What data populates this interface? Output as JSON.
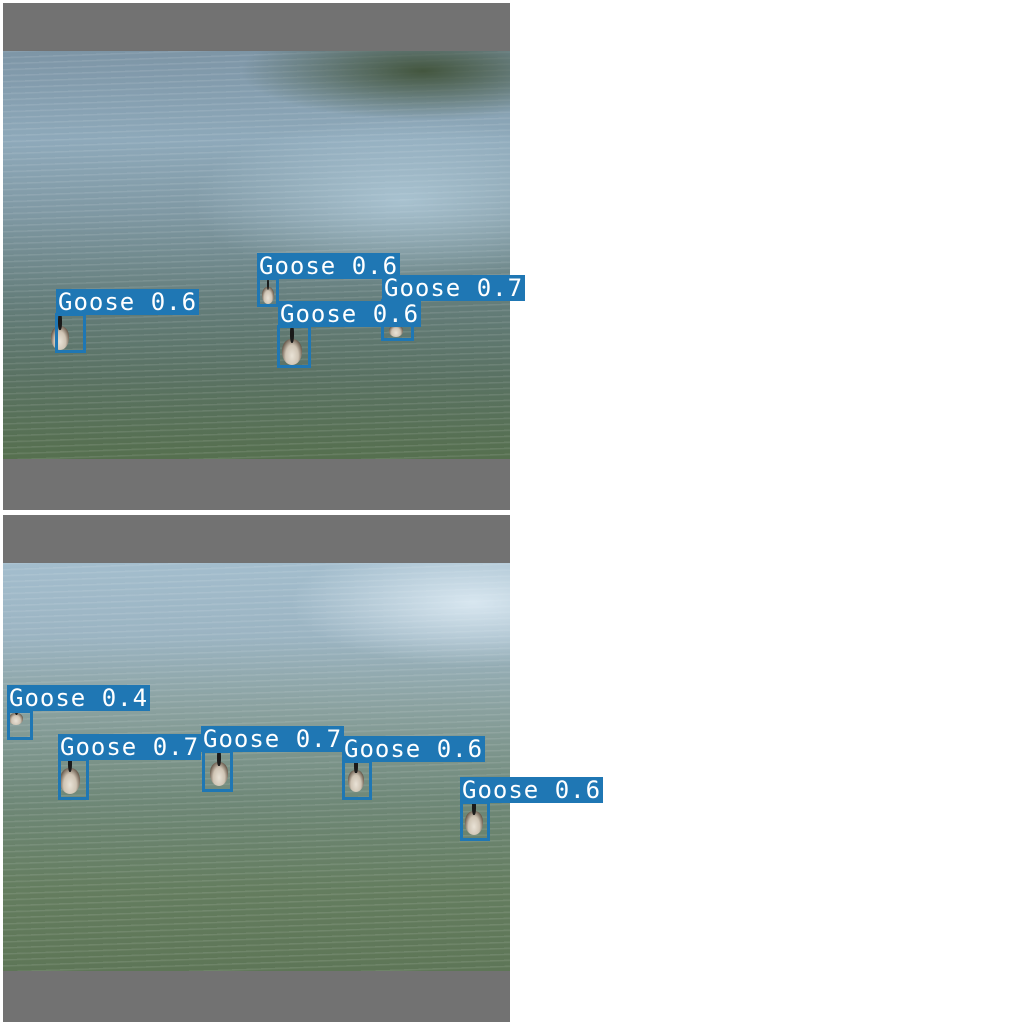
{
  "detections_top": [
    {
      "label": "Goose 0.6"
    },
    {
      "label": "Goose 0.6"
    },
    {
      "label": "Goose 0.7"
    },
    {
      "label": "Goose 0.6"
    }
  ],
  "detections_bottom": [
    {
      "label": "Goose 0.4"
    },
    {
      "label": "Goose 0.7"
    },
    {
      "label": "Goose 0.7"
    },
    {
      "label": "Goose 0.6"
    },
    {
      "label": "Goose 0.6"
    }
  ],
  "colors": {
    "box": "#1f77b4",
    "label_text": "#ffffff",
    "padding": "#727272",
    "background": "#ffffff"
  }
}
